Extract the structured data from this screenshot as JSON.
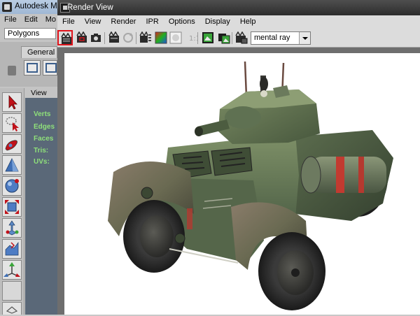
{
  "maya": {
    "title": "Autodesk M",
    "menu": [
      "File",
      "Edit",
      "Mo"
    ],
    "mode_select": "Polygons",
    "shelf_tab": "General",
    "viewport_menu": "View",
    "hud": [
      "Verts",
      "Edges",
      "Faces",
      "Tris:",
      "UVs:"
    ],
    "tools": [
      "select-arrow-icon",
      "lasso-icon",
      "paint-icon",
      "move-icon",
      "rotate-icon",
      "scale-icon",
      "universal-manipulator-icon",
      "soft-mod-icon",
      "show-manipulator-icon"
    ]
  },
  "render_view": {
    "title": "Render View",
    "menu": [
      "File",
      "View",
      "Render",
      "IPR",
      "Options",
      "Display",
      "Help"
    ],
    "toolbar_icons": [
      "redo-previous-render-icon",
      "render-region-icon",
      "snapshot-icon",
      "ipr-render-icon",
      "refresh-ipr-icon",
      "render-settings-icon",
      "rgb-channels-icon",
      "alpha-channel-icon",
      "real-size-icon",
      "keep-image-icon",
      "remove-image-icon",
      "render-globals-icon"
    ],
    "renderer": "mental ray",
    "image_subject": "armored-car-render"
  },
  "colors": {
    "highlight": "#e0141c",
    "rv_title_bar": "#333333",
    "viewport_hud": "#8fe07a"
  }
}
